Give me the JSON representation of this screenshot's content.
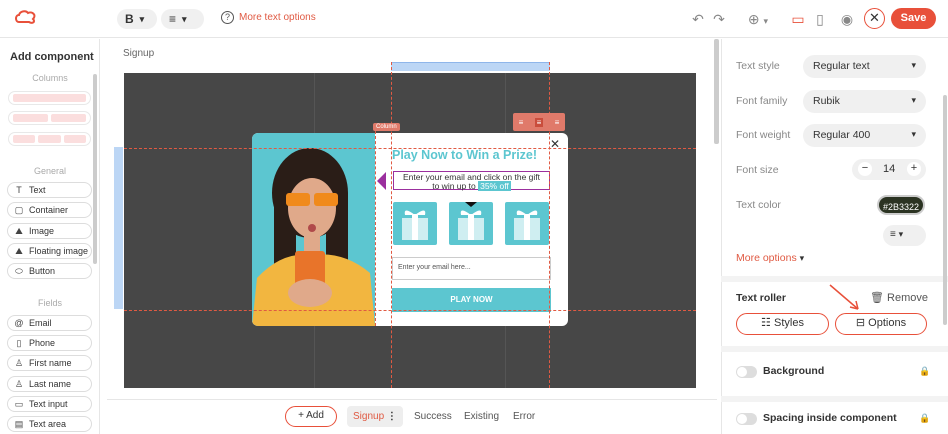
{
  "toolbar": {
    "bold_label": "B",
    "more_text_options": "More text options",
    "save_label": "Save"
  },
  "left_panel": {
    "title": "Add component",
    "columns_heading": "Columns",
    "general_heading": "General",
    "general_items": [
      {
        "label": "Text",
        "icon": "text-icon"
      },
      {
        "label": "Container",
        "icon": "container-icon"
      },
      {
        "label": "Image",
        "icon": "image-icon"
      },
      {
        "label": "Floating image",
        "icon": "floating-image-icon"
      },
      {
        "label": "Button",
        "icon": "button-icon"
      }
    ],
    "fields_heading": "Fields",
    "field_items": [
      {
        "label": "Email",
        "icon": "at-icon"
      },
      {
        "label": "Phone",
        "icon": "phone-icon"
      },
      {
        "label": "First name",
        "icon": "person-icon"
      },
      {
        "label": "Last name",
        "icon": "person-icon"
      },
      {
        "label": "Text input",
        "icon": "input-icon"
      },
      {
        "label": "Text area",
        "icon": "textarea-icon"
      }
    ]
  },
  "canvas": {
    "breadcrumb": "Signup",
    "column_tag": "Column",
    "popup": {
      "title": "Play Now to Win a Prize!",
      "desc_line1": "Enter your email and click on the gift",
      "desc_line2": "to win up to",
      "discount": "35% off",
      "email_placeholder": "Enter your email here...",
      "button_label": "PLAY NOW",
      "close_symbol": "✕"
    }
  },
  "bottom": {
    "add_label": "Add",
    "steps": [
      "Signup",
      "Success",
      "Existing",
      "Error"
    ]
  },
  "right_panel": {
    "text_style_label": "Text style",
    "text_style_value": "Regular text",
    "font_family_label": "Font family",
    "font_family_value": "Rubik",
    "font_weight_label": "Font weight",
    "font_weight_value": "Regular 400",
    "font_size_label": "Font size",
    "font_size_value": "14",
    "text_color_label": "Text color",
    "text_color_value": "#2B3322",
    "more_options": "More options",
    "section_title": "Text roller",
    "remove_label": "Remove",
    "styles_label": "Styles",
    "options_label": "Options",
    "background_label": "Background",
    "spacing_label": "Spacing inside component"
  },
  "colors": {
    "accent": "#e8503a",
    "teal": "#5cc6d0",
    "canvas_bg": "#474747"
  }
}
